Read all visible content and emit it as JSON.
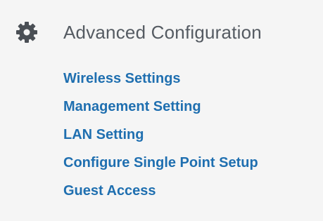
{
  "section": {
    "icon": "gear-icon",
    "title": "Advanced Configuration"
  },
  "links": [
    {
      "label": "Wireless Settings"
    },
    {
      "label": "Management Setting"
    },
    {
      "label": "LAN Setting"
    },
    {
      "label": "Configure Single Point Setup"
    },
    {
      "label": "Guest Access"
    }
  ],
  "colors": {
    "background": "#f5f5f5",
    "title": "#555b62",
    "icon": "#4a4f55",
    "link": "#1f6fb0"
  }
}
